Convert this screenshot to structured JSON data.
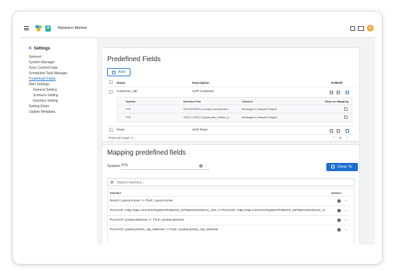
{
  "app": {
    "title": "Advantco Monitor",
    "logo_letter": "A",
    "avatar_initial": "A"
  },
  "topbar_icons": [
    "app-switcher-icon",
    "mail-icon"
  ],
  "sidebar": {
    "heading": "Settings",
    "items": [
      {
        "label": "General",
        "level": 0,
        "active": false
      },
      {
        "label": "System Manager",
        "level": 0,
        "active": false
      },
      {
        "label": "Sync Cached Data",
        "level": 0,
        "active": false
      },
      {
        "label": "Scheduled Task Manager",
        "level": 0,
        "active": false
      },
      {
        "label": "Predefined Fields",
        "level": 0,
        "active": true
      },
      {
        "label": "Alert Settings",
        "level": 0,
        "active": false
      },
      {
        "label": "General Setting",
        "level": 1,
        "active": false
      },
      {
        "label": "Scenario Setting",
        "level": 1,
        "active": false
      },
      {
        "label": "Interface Setting",
        "level": 1,
        "active": false
      },
      {
        "label": "Setting Roles",
        "level": 0,
        "active": false
      },
      {
        "label": "Update Metadata",
        "level": 0,
        "active": false
      }
    ]
  },
  "predefined": {
    "title": "Predefined Fields",
    "add_label": "Add",
    "columns": {
      "name": "Name",
      "description": "Description",
      "actions": "Del/Edit"
    },
    "rows": [
      {
        "name": "Customer_Nb",
        "description": "SAP Customer"
      },
      {
        "name": "Plant",
        "description": "SAP Plant"
      }
    ],
    "subtable": {
      "columns": {
        "system": "System",
        "interface_pair": "Interface Pair",
        "channel": "Channel",
        "show": "Show on Mapping"
      },
      "rows": [
        {
          "system": "P75",
          "interface_pair": "IDOC/ATI900 | um:sap-com:docume...",
          "channel": "Messages in Adapter Engine"
        },
        {
          "system": "P75",
          "interface_pair": "SFDC | SFDC:Opportunity_Closed_a...",
          "channel": "Messages in Adapter Engine"
        }
      ]
    },
    "pager": {
      "rows_per_page": "Rows per page: 5",
      "page": "1"
    }
  },
  "mapping": {
    "title": "Mapping predefined fields",
    "system_label": "System:",
    "system_value": "P75",
    "clone_label": "Clone To",
    "search_placeholder": "Search interface...",
    "columns": {
      "interface": "Interface",
      "actions": "Actions"
    },
    "rows": [
      "Neo4J | query.movie >> FILE | query.movie",
      "PULSAR | http://sap.com/xi/XI/System/Patterns_KiPatternInterface1_Out >> PULSAR | http://sap.com/xi/XI/System/Patterns_KiPatternInterface1_In",
      "PULSAR | pulsar.debmas >> FILE | pulsar.debmas",
      "PULSAR | pulsar.presto_sql_debmas >> FILE | pulsar.presto_sql_debmas"
    ]
  }
}
